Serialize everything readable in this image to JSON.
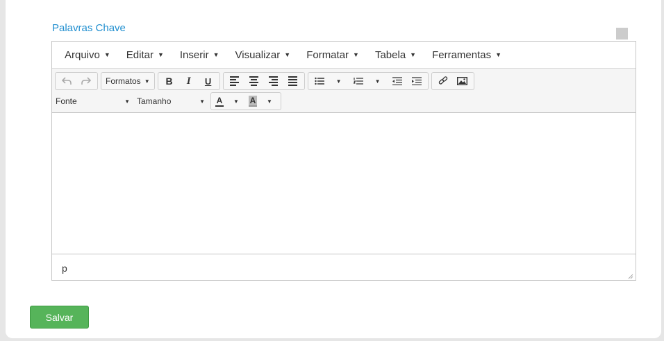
{
  "field": {
    "label": "Palavras Chave"
  },
  "menubar": {
    "items": [
      {
        "label": "Arquivo"
      },
      {
        "label": "Editar"
      },
      {
        "label": "Inserir"
      },
      {
        "label": "Visualizar"
      },
      {
        "label": "Formatar"
      },
      {
        "label": "Tabela"
      },
      {
        "label": "Ferramentas"
      }
    ]
  },
  "toolbar": {
    "formats_label": "Formatos",
    "bold_label": "B",
    "italic_label": "I",
    "underline_label": "U",
    "font_select": "Fonte",
    "size_select": "Tamanho",
    "text_color_label": "A",
    "bg_color_label": "A",
    "icons": [
      "undo-icon",
      "redo-icon",
      "align-left-icon",
      "align-center-icon",
      "align-right-icon",
      "align-justify-icon",
      "bullet-list-icon",
      "numbered-list-icon",
      "outdent-icon",
      "indent-icon",
      "link-icon",
      "image-icon"
    ]
  },
  "statusbar": {
    "path": "p"
  },
  "actions": {
    "save_label": "Salvar"
  },
  "colors": {
    "accent": "#1f8ecf",
    "save_button": "#56b45a"
  }
}
